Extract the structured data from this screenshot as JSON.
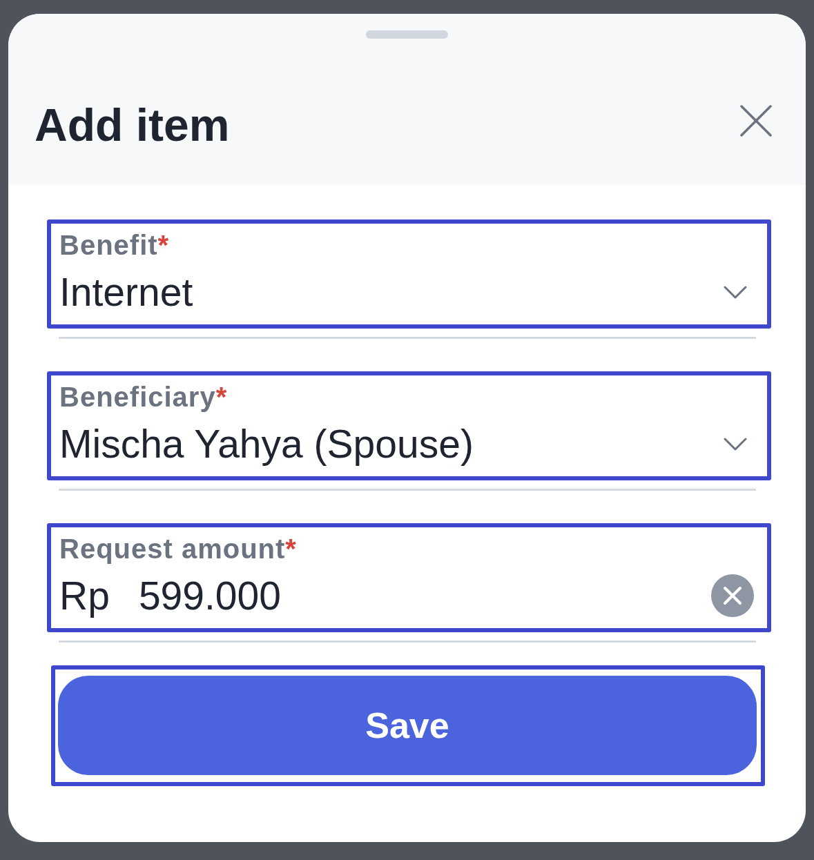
{
  "sheet": {
    "title": "Add item"
  },
  "fields": [
    {
      "kind": "select",
      "label": "Benefit",
      "required_mark": "*",
      "value": "Internet",
      "highlighted": true
    },
    {
      "kind": "select",
      "label": "Beneficiary",
      "required_mark": "*",
      "value": "Mischa Yahya (Spouse)",
      "highlighted": true
    },
    {
      "kind": "amount",
      "label": "Request amount",
      "required_mark": "*",
      "prefix": "Rp",
      "value": "599.000",
      "highlighted": true
    }
  ],
  "save_button": {
    "label": "Save",
    "highlighted": true
  }
}
